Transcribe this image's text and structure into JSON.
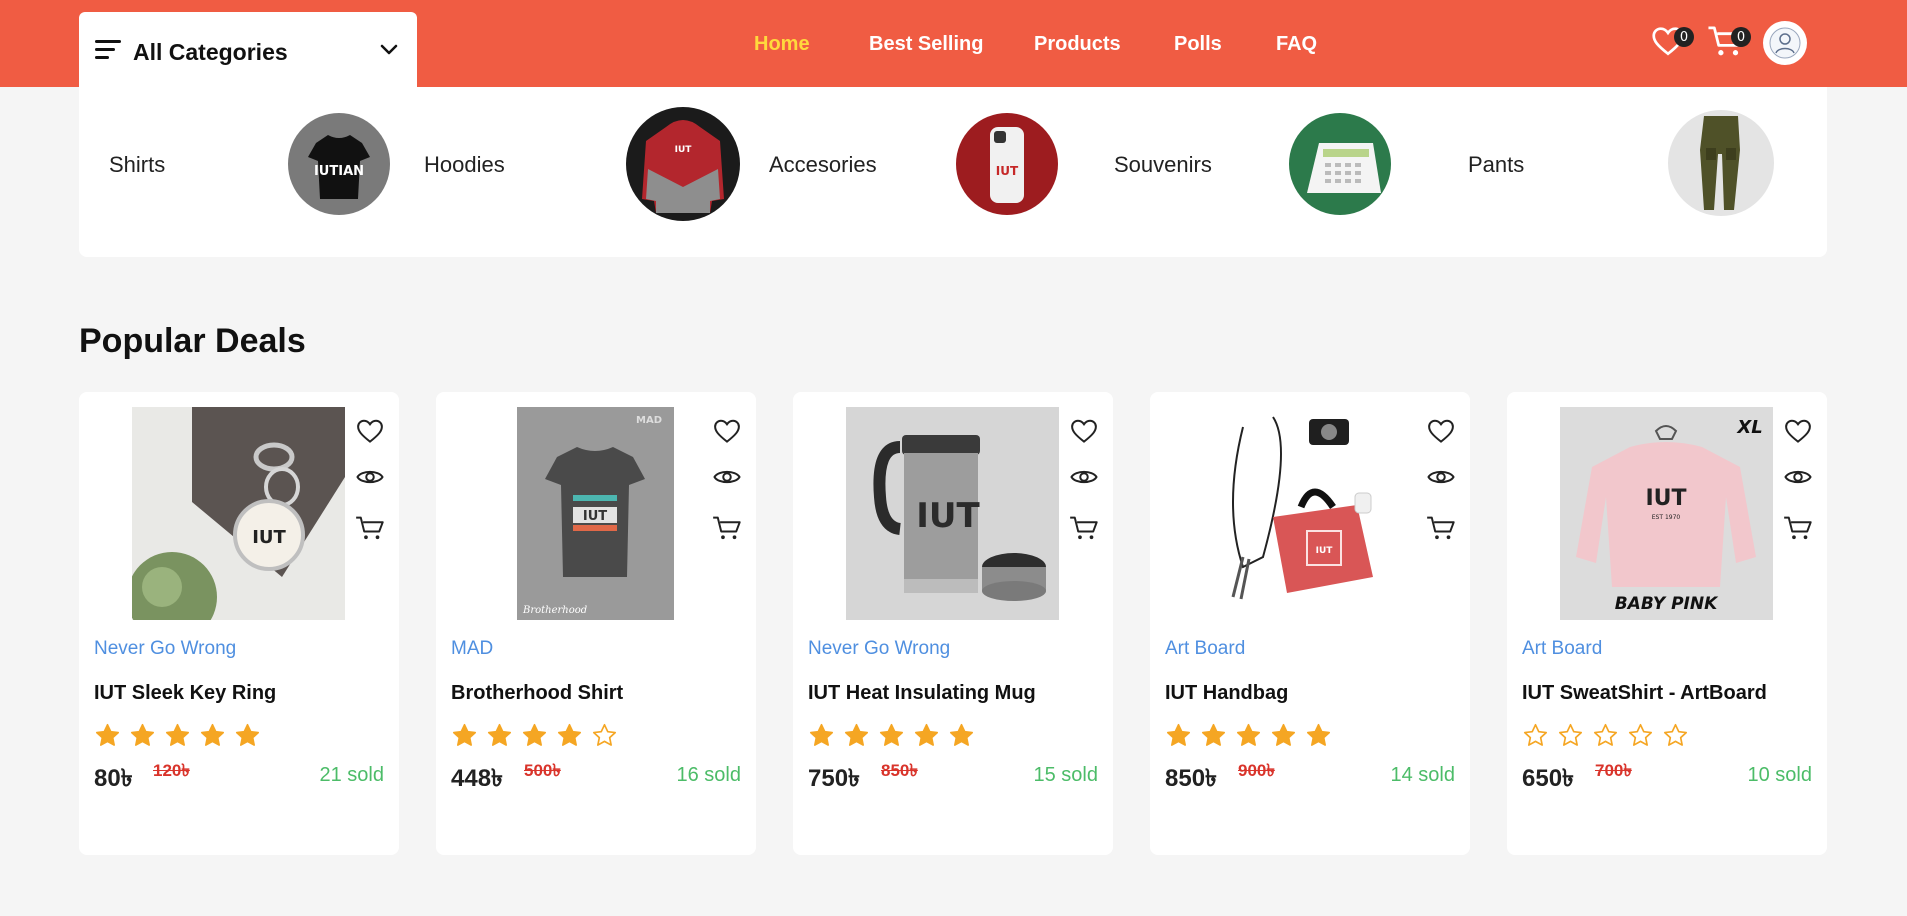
{
  "colors": {
    "brand": "#f05c43",
    "active_nav": "#ffd93d",
    "shop_link": "#4f8fe0",
    "sold": "#4cbc68",
    "old_price": "#d9342b",
    "star": "#f5a623"
  },
  "header": {
    "category_dropdown": {
      "label": "All Categories",
      "icon": "menu-icon",
      "caret": "chevron-down-icon"
    },
    "nav": [
      {
        "label": "Home",
        "active": true
      },
      {
        "label": "Best Selling",
        "active": false
      },
      {
        "label": "Products",
        "active": false
      },
      {
        "label": "Polls",
        "active": false
      },
      {
        "label": "FAQ",
        "active": false
      }
    ],
    "wishlist_count": "0",
    "cart_count": "0"
  },
  "categories": [
    {
      "name": "Shirts",
      "thumb": "black t-shirt"
    },
    {
      "name": "Hoodies",
      "thumb": "red hoodie"
    },
    {
      "name": "Accesories",
      "thumb": "phone case"
    },
    {
      "name": "Souvenirs",
      "thumb": "desk calendar"
    },
    {
      "name": "Pants",
      "thumb": "cargo pants"
    }
  ],
  "popular": {
    "title": "Popular Deals",
    "products": [
      {
        "shop": "Never Go Wrong",
        "name": "IUT Sleek Key Ring",
        "rating": 5,
        "price": "80৳",
        "old_price": "120৳",
        "sold": "21 sold"
      },
      {
        "shop": "MAD",
        "name": "Brotherhood Shirt",
        "rating": 4,
        "price": "448৳",
        "old_price": "500৳",
        "sold": "16 sold"
      },
      {
        "shop": "Never Go Wrong",
        "name": "IUT Heat Insulating Mug",
        "rating": 5,
        "price": "750৳",
        "old_price": "850৳",
        "sold": "15 sold"
      },
      {
        "shop": "Art Board",
        "name": "IUT Handbag",
        "rating": 5,
        "price": "850৳",
        "old_price": "900৳",
        "sold": "14 sold"
      },
      {
        "shop": "Art Board",
        "name": "IUT SweatShirt - ArtBoard",
        "rating": 0,
        "price": "650৳",
        "old_price": "700৳",
        "sold": "10 sold"
      }
    ]
  },
  "image_text": {
    "shirt_thumb": "IUTIAN",
    "brotherhood_logo": "MAD",
    "brotherhood_mark": "Brotherhood",
    "sweatshirt_size": "XL",
    "sweatshirt_color": "BABY PINK",
    "sweatshirt_est": "EST 1970",
    "iut_mark": "IUT"
  }
}
